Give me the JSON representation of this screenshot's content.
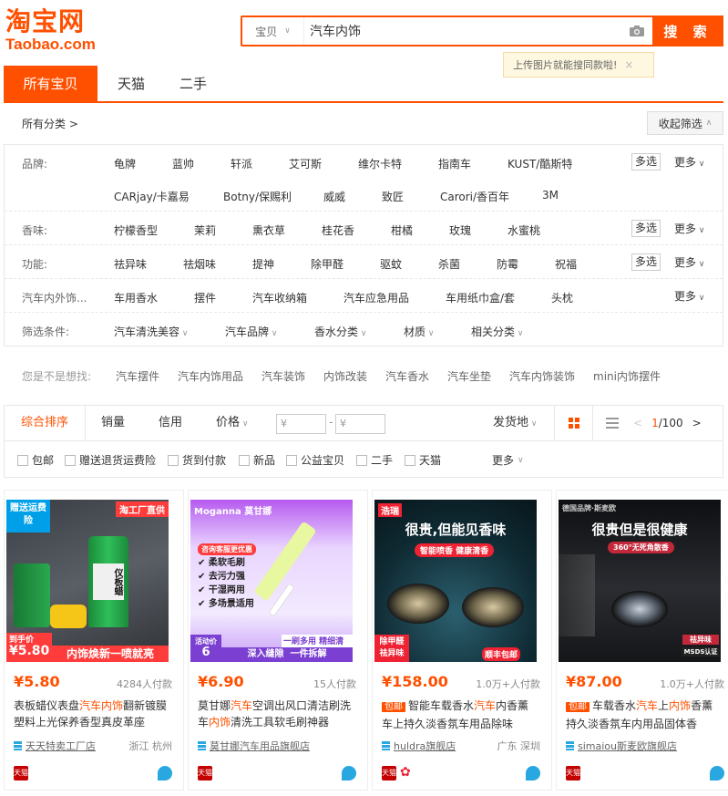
{
  "logo": {
    "cn": "淘宝网",
    "en": "Taobao.com"
  },
  "search": {
    "category": "宝贝",
    "value": "汽车内饰",
    "button": "搜 索"
  },
  "tip": {
    "text": "上传图片就能搜同款啦!",
    "close": "×"
  },
  "tabs": [
    "所有宝贝",
    "天猫",
    "二手"
  ],
  "crumb": "所有分类 >",
  "collapse": "收起筛选",
  "filters": {
    "brand_label": "品牌:",
    "brands_row1": [
      "龟牌",
      "蓝帅",
      "轩派",
      "艾可斯",
      "维尔卡特",
      "指南车",
      "KUST/酷斯特"
    ],
    "brands_row2": [
      "CARjay/卡嘉易",
      "Botny/保赐利",
      "威威",
      "致匠",
      "Carori/香百年",
      "3M"
    ],
    "scent_label": "香味:",
    "scents": [
      "柠檬香型",
      "茉莉",
      "熏衣草",
      "桂花香",
      "柑橘",
      "玫瑰",
      "水蜜桃"
    ],
    "func_label": "功能:",
    "funcs": [
      "祛异味",
      "祛烟味",
      "提神",
      "除甲醛",
      "驱蚊",
      "杀菌",
      "防霉",
      "祝福"
    ],
    "acc_label": "汽车内外饰...",
    "accs": [
      "车用香水",
      "摆件",
      "汽车收纳箱",
      "汽车应急用品",
      "车用纸巾盒/套",
      "头枕"
    ],
    "cond_label": "筛选条件:",
    "conds": [
      "汽车清洗美容",
      "汽车品牌",
      "香水分类",
      "材质",
      "相关分类"
    ],
    "multi": "多选",
    "more": "更多"
  },
  "guess": {
    "label": "您是不是想找:",
    "items": [
      "汽车摆件",
      "汽车内饰用品",
      "汽车装饰",
      "内饰改装",
      "汽车香水",
      "汽车坐垫",
      "汽车内饰装饰",
      "mini内饰摆件"
    ]
  },
  "sort": {
    "items": [
      "综合排序",
      "销量",
      "信用",
      "价格"
    ],
    "price_placeholder": "¥",
    "price_dash": "-",
    "ship": "发货地",
    "pager_current": "1",
    "pager_total": "/100"
  },
  "checks": [
    "包邮",
    "赠送退货运费险",
    "货到付款",
    "新品",
    "公益宝贝",
    "二手",
    "天猫"
  ],
  "checks_more": "更多",
  "products": [
    {
      "price": "¥5.80",
      "paid": "4284人付款",
      "title_pre": "表板蜡仪表盘",
      "title_hl1": "汽车内饰",
      "title_mid": "翻新镀膜塑料上光保养香型真皮革座",
      "title_hl2": "",
      "title_post": "",
      "tag": "",
      "shop": "天天特卖工厂店",
      "loc": "浙江 杭州",
      "img_badge1": "赠送运费险",
      "img_badge2": "淘工厂直供",
      "img_price_label": "到手价",
      "img_price": "¥5.80",
      "img_slogan": "内饰焕新一喷就亮",
      "img_can": "仪板蜡"
    },
    {
      "price": "¥6.90",
      "paid": "15人付款",
      "title_pre": "莫甘娜",
      "title_hl1": "汽车",
      "title_mid": "空调出风口清洁刷洗车",
      "title_hl2": "内饰",
      "title_post": "清洗工具软毛刷神器",
      "tag": "",
      "shop": "莫甘娜汽车用品旗舰店",
      "loc": "",
      "img_brand": "Moganna 莫甘娜",
      "img_head": "咨询客服更优惠",
      "img_list": [
        "柔软毛刷",
        "去污力强",
        "干湿两用",
        "多场景适用"
      ],
      "img_price_label": "活动价",
      "img_price": "6",
      "img_slogan1": "深入缝隙",
      "img_slogan2": "一件拆解",
      "img_tag1": "一刷多用",
      "img_tag2": "精细清洁"
    },
    {
      "price": "¥158.00",
      "paid": "1.0万+人付款",
      "title_pre": "智能车载香水",
      "title_hl1": "汽车",
      "title_mid": "内香薰车上持久淡香氛车用品除味",
      "title_hl2": "",
      "title_post": "",
      "tag": "包邮",
      "shop": "huldra旗舰店",
      "loc": "广东 深圳",
      "img_brand": "浩瑞",
      "img_head": "很贵,但能见香味",
      "img_sub": "智能喷香 健康清香",
      "img_tag1": "除甲醛",
      "img_tag2": "祛异味",
      "img_tag3": "顺丰包邮"
    },
    {
      "price": "¥87.00",
      "paid": "1.0万+人付款",
      "title_pre": "车载香水",
      "title_hl1": "汽车",
      "title_mid": "上",
      "title_hl2": "内饰",
      "title_post": "香薰持久淡香氛车内用品固体香",
      "tag": "包邮",
      "shop": "simaiou斯麦欧旗舰店",
      "loc": "",
      "img_brand": "德国品牌·斯麦欧",
      "img_head": "很贵但是很健康",
      "img_sub": "360°无死角散香",
      "img_tag1": "祛异味",
      "img_tag2": "MSDS认证"
    }
  ]
}
